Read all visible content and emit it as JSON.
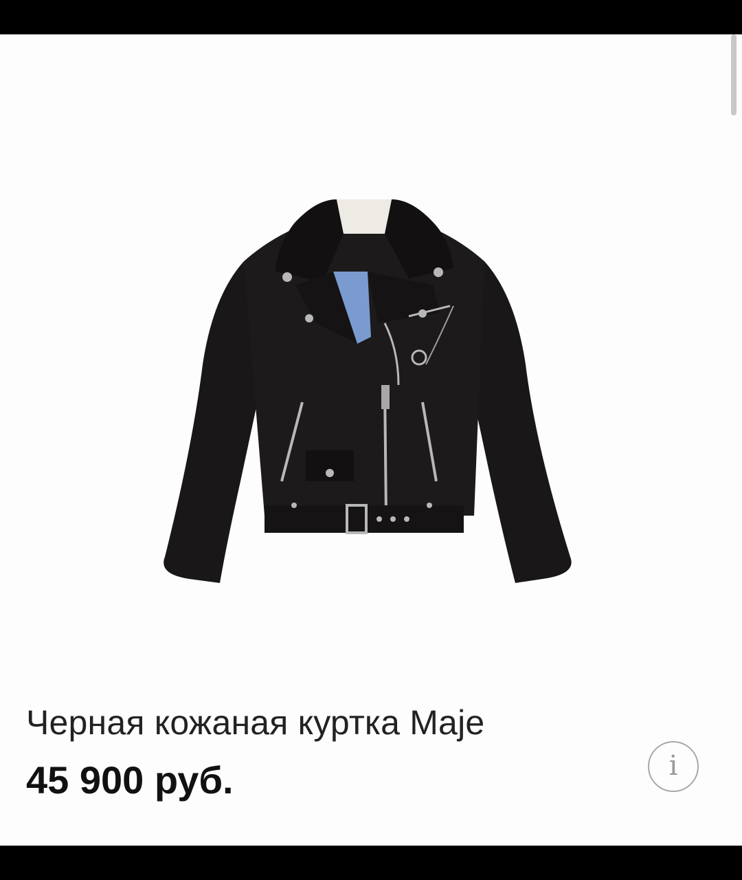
{
  "product": {
    "title": "Черная кожаная куртка Maje",
    "price": "45 900 руб.",
    "image": {
      "icon": "leather-biker-jacket-image",
      "jacket_color": "#161414",
      "lining_color": "#7b9bd0",
      "hardware_color": "#b8b8b8"
    }
  },
  "info_button": {
    "icon": "info-icon",
    "glyph": "i",
    "color": "#a8a8a8"
  },
  "colors": {
    "background": "#fdfdfd",
    "frame": "#000000",
    "title_text": "#222222",
    "price_text": "#111111",
    "scrollbar": "#c8c8c8"
  }
}
